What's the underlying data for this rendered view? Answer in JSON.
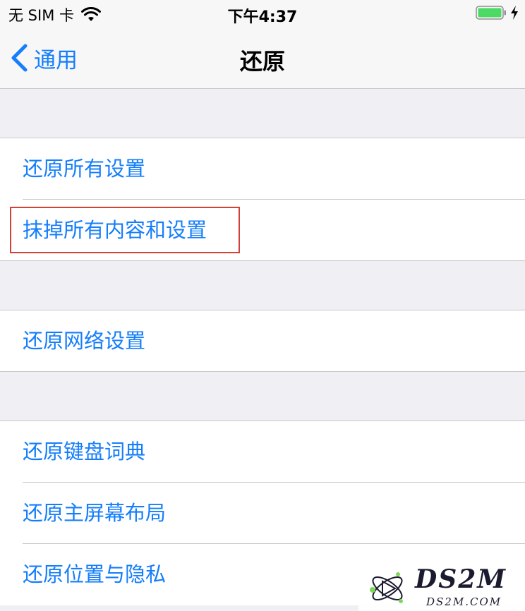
{
  "status_bar": {
    "carrier": "无 SIM 卡",
    "time": "下午4:37",
    "wifi_icon": "wifi-icon",
    "battery_icon": "battery-charging-icon"
  },
  "nav": {
    "back_label": "通用",
    "title": "还原"
  },
  "groups": [
    {
      "items": [
        "还原所有设置",
        "抹掉所有内容和设置"
      ]
    },
    {
      "items": [
        "还原网络设置"
      ]
    },
    {
      "items": [
        "还原键盘词典",
        "还原主屏幕布局",
        "还原位置与隐私"
      ]
    }
  ],
  "highlighted_item": "抹掉所有内容和设置",
  "colors": {
    "accent": "#157efb",
    "background": "#efeff4",
    "separator": "#c8c7cc",
    "highlight_border": "#d4403a",
    "battery": "#4cd964"
  },
  "watermark": {
    "brand": "DS2M",
    "domain": "DS2M.COM"
  }
}
